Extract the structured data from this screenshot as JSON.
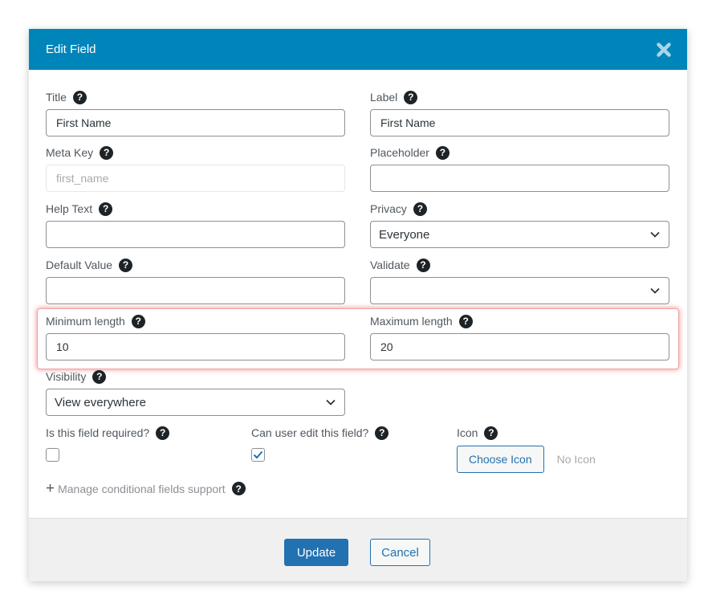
{
  "modal": {
    "title": "Edit Field",
    "close_icon": "close-x-icon"
  },
  "fields": {
    "title": {
      "label": "Title",
      "value": "First Name"
    },
    "label": {
      "label": "Label",
      "value": "First Name"
    },
    "meta_key": {
      "label": "Meta Key",
      "placeholder": "first_name",
      "disabled": true
    },
    "placeholder": {
      "label": "Placeholder",
      "value": ""
    },
    "help_text": {
      "label": "Help Text",
      "value": ""
    },
    "privacy": {
      "label": "Privacy",
      "selected": "Everyone"
    },
    "default_value": {
      "label": "Default Value",
      "value": ""
    },
    "validate": {
      "label": "Validate",
      "selected": ""
    },
    "min_length": {
      "label": "Minimum length",
      "value": "10"
    },
    "max_length": {
      "label": "Maximum length",
      "value": "20"
    },
    "visibility": {
      "label": "Visibility",
      "selected": "View everywhere"
    },
    "required": {
      "label": "Is this field required?",
      "checked": false
    },
    "editable": {
      "label": "Can user edit this field?",
      "checked": true
    },
    "icon": {
      "label": "Icon",
      "button_label": "Choose Icon",
      "status": "No Icon"
    }
  },
  "conditional": {
    "label": "Manage conditional fields support"
  },
  "footer": {
    "update_label": "Update",
    "cancel_label": "Cancel"
  },
  "help_symbol": "?",
  "colors": {
    "header": "#0085ba",
    "primary": "#2271b1",
    "highlight": "#f0a3a3",
    "footer": "#f0f0f1"
  }
}
